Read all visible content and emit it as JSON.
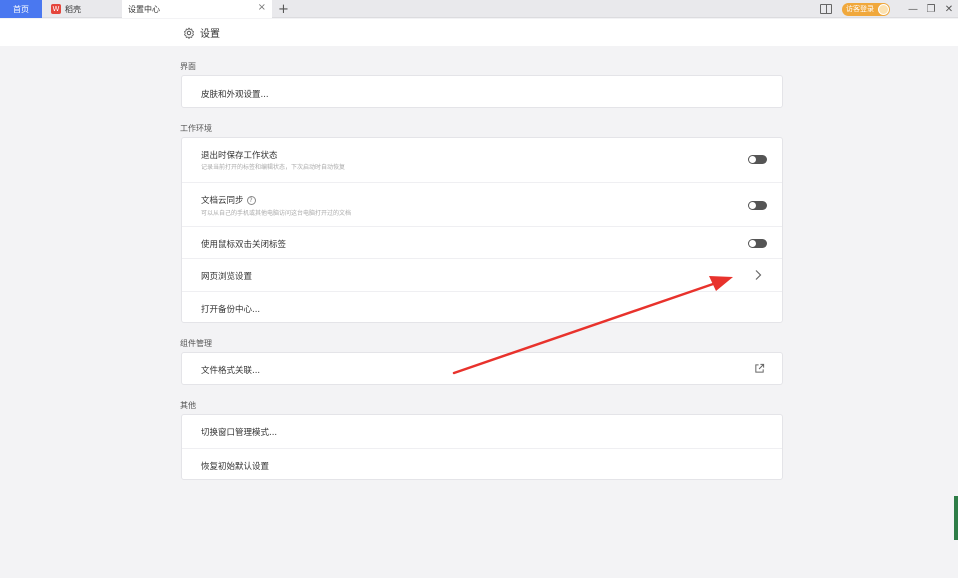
{
  "tabs": {
    "home": "首页",
    "wps": "稻壳",
    "settings": "设置中心",
    "close": "×",
    "new_tab": "+"
  },
  "window": {
    "login_label": "访客登录",
    "minimize": "—",
    "restore": "❐",
    "close": "✕"
  },
  "page": {
    "title": "设置"
  },
  "sections": {
    "interface": {
      "label": "界面",
      "items": [
        {
          "label": "皮肤和外观设置..."
        }
      ]
    },
    "work_env": {
      "label": "工作环境",
      "items": [
        {
          "label": "退出时保存工作状态",
          "sub": "记录当前打开的标签和编辑状态，下次启动时自动恢复",
          "toggle": "off"
        },
        {
          "label": "文档云同步",
          "sub": "可以从自己的手机或其他电脑访问这台电脑打开过的文档",
          "toggle": "off",
          "help": "?"
        },
        {
          "label": "使用鼠标双击关闭标签",
          "toggle": "off"
        },
        {
          "label": "网页浏览设置"
        },
        {
          "label": "打开备份中心..."
        }
      ]
    },
    "components": {
      "label": "组件管理",
      "items": [
        {
          "label": "文件格式关联..."
        }
      ]
    },
    "other": {
      "label": "其他",
      "items": [
        {
          "label": "切换窗口管理模式..."
        },
        {
          "label": "恢复初始默认设置"
        }
      ]
    }
  },
  "colors": {
    "accent": "#4a78f0",
    "login": "#f0a83c",
    "annotation_arrow": "#e8322c"
  },
  "icons": [
    "gear-icon",
    "help-icon",
    "chevron-right-icon",
    "external-link-icon",
    "book-icon",
    "user-avatar-icon"
  ]
}
